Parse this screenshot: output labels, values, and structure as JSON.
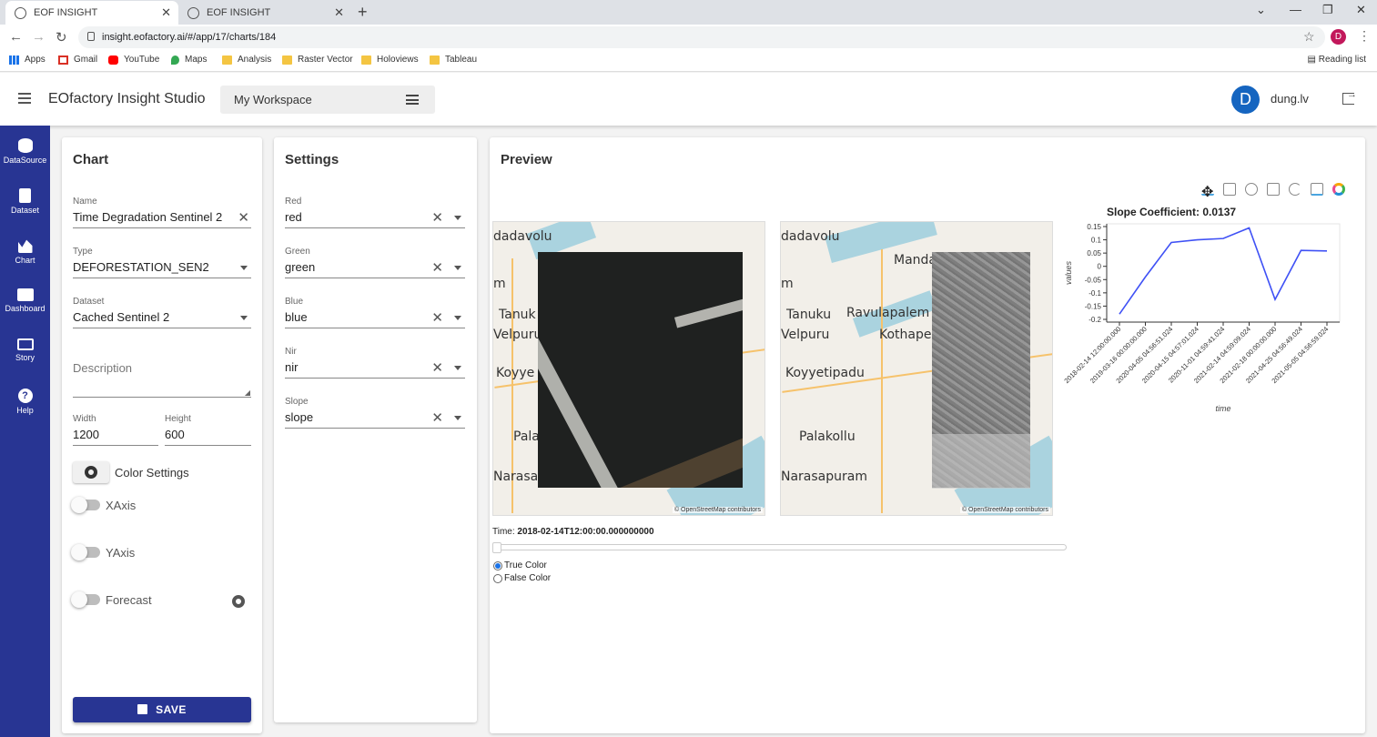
{
  "browser": {
    "tabs": [
      {
        "title": "EOF INSIGHT",
        "active": true
      },
      {
        "title": "EOF INSIGHT",
        "active": false
      }
    ],
    "url": "insight.eofactory.ai/#/app/17/charts/184",
    "profile_initial": "D",
    "bookmarks": [
      "Apps",
      "Gmail",
      "YouTube",
      "Maps",
      "Analysis",
      "Raster Vector",
      "Holoviews",
      "Tableau"
    ],
    "reading_list": "Reading list"
  },
  "header": {
    "app_title": "EOfactory Insight Studio",
    "workspace": "My Workspace",
    "avatar_initial": "D",
    "username": "dung.lv"
  },
  "sidebar": {
    "items": [
      {
        "label": "DataSource",
        "icon": "database-icon"
      },
      {
        "label": "Dataset",
        "icon": "document-icon"
      },
      {
        "label": "Chart",
        "icon": "chart-icon"
      },
      {
        "label": "Dashboard",
        "icon": "dashboard-icon"
      },
      {
        "label": "Story",
        "icon": "monitor-icon"
      },
      {
        "label": "Help",
        "icon": "help-icon"
      }
    ],
    "color": "#283593"
  },
  "chart_panel": {
    "title": "Chart",
    "name_label": "Name",
    "name_value": "Time Degradation Sentinel 2",
    "type_label": "Type",
    "type_value": "DEFORESTATION_SEN2",
    "dataset_label": "Dataset",
    "dataset_value": "Cached Sentinel 2",
    "description_placeholder": "Description",
    "width_label": "Width",
    "width_value": "1200",
    "height_label": "Height",
    "height_value": "600",
    "color_settings": "Color Settings",
    "toggles": [
      {
        "label": "XAxis",
        "on": false
      },
      {
        "label": "YAxis",
        "on": false
      },
      {
        "label": "Forecast",
        "on": false
      }
    ],
    "save": "SAVE"
  },
  "settings_panel": {
    "title": "Settings",
    "fields": [
      {
        "label": "Red",
        "value": "red"
      },
      {
        "label": "Green",
        "value": "green"
      },
      {
        "label": "Blue",
        "value": "blue"
      },
      {
        "label": "Nir",
        "value": "nir"
      },
      {
        "label": "Slope",
        "value": "slope"
      }
    ]
  },
  "preview": {
    "title": "Preview",
    "map_labels_left": [
      "dadavolu",
      "m",
      "Tanuk",
      "Velpuru",
      "Koyye",
      "Pala",
      "Narasap"
    ],
    "map_labels_right": [
      "dadavolu",
      "Manda",
      "m",
      "Tanuku",
      "Ravulapalem",
      "Velpuru",
      "Kothape",
      "Koyyetipadu",
      "Palakollu",
      "Narasapuram"
    ],
    "attribution": "© OpenStreetMap contributors",
    "time_label": "Time:",
    "time_value": "2018-02-14T12:00:00.000000000",
    "radios": [
      {
        "label": "True Color",
        "checked": true
      },
      {
        "label": "False Color",
        "checked": false
      }
    ],
    "toolbar": [
      "pan-icon",
      "box-zoom-icon",
      "wheel-zoom-icon",
      "save-icon",
      "reset-icon",
      "hover-icon",
      "bokeh-logo-icon"
    ]
  },
  "chart_data": {
    "type": "line",
    "title": "Slope Coefficient: 0.0137",
    "xlabel": "time",
    "ylabel": "values",
    "x": [
      "2018-02-14 12:00:00.000",
      "2019-03-16 00:00:00.000",
      "2020-04-05 04:56:51.024",
      "2020-04-15 04:57:01.024",
      "2020-11-01 04:59:41.024",
      "2021-02-14 04:59:09.024",
      "2021-02-18 00:00:00.000",
      "2021-04-25 04:56:49.024",
      "2021-05-05 04:56:59.024"
    ],
    "series": [
      {
        "values": [
          -0.18,
          -0.04,
          0.09,
          0.1,
          0.105,
          0.145,
          -0.125,
          0.06,
          0.058
        ]
      }
    ],
    "yticks": [
      "0.15",
      "0.1",
      "0.05",
      "0",
      "-0.05",
      "-0.1",
      "-0.15",
      "-0.2"
    ],
    "ylim": [
      -0.2,
      0.15
    ],
    "line_color": "#3f51f5",
    "grid": false
  }
}
